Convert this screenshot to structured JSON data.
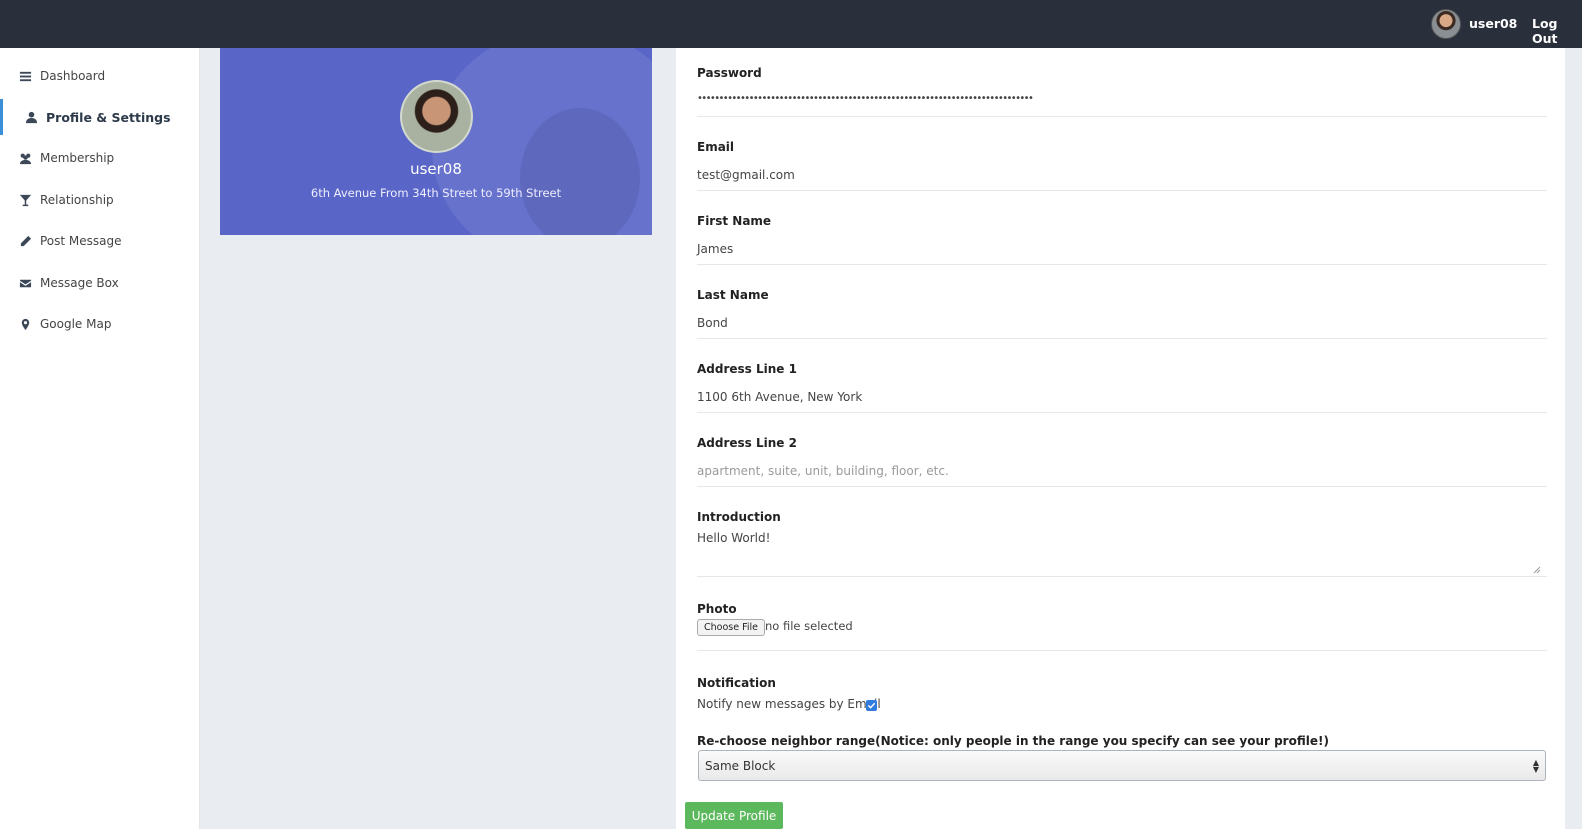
{
  "topbar": {
    "username": "user08",
    "logout": "Log Out"
  },
  "sidebar": {
    "items": [
      {
        "label": "Dashboard",
        "icon": "bars-icon"
      },
      {
        "label": "Profile & Settings",
        "icon": "user-icon"
      },
      {
        "label": "Membership",
        "icon": "users-icon"
      },
      {
        "label": "Relationship",
        "icon": "glass-icon"
      },
      {
        "label": "Post Message",
        "icon": "pencil-icon"
      },
      {
        "label": "Message Box",
        "icon": "envelope-icon"
      },
      {
        "label": "Google Map",
        "icon": "map-marker-icon"
      }
    ],
    "active": "Profile & Settings"
  },
  "hero": {
    "username": "user08",
    "address": "6th Avenue From 34th Street to 59th Street"
  },
  "form": {
    "password": {
      "label": "Password",
      "value": "••••••••••••••••••••••••••••••••••••••••••••••••••••••••••••••••••••••••••••••"
    },
    "email": {
      "label": "Email",
      "value": "test@gmail.com"
    },
    "first_name": {
      "label": "First Name",
      "value": "James"
    },
    "last_name": {
      "label": "Last Name",
      "value": "Bond"
    },
    "address1": {
      "label": "Address Line 1",
      "value": "1100 6th Avenue, New York"
    },
    "address2": {
      "label": "Address Line 2",
      "placeholder": "apartment, suite, unit, building, floor, etc."
    },
    "introduction": {
      "label": "Introduction",
      "value": "Hello World!"
    },
    "photo": {
      "label": "Photo",
      "button": "Choose File",
      "status": "no file selected"
    },
    "notification": {
      "label": "Notification",
      "option": "Notify new messages by Email",
      "checked": true
    },
    "neighbor": {
      "label": "Re-choose neighbor range(Notice: only people in the range you specify can see your profile!)",
      "selected": "Same Block"
    },
    "submit": "Update Profile"
  },
  "colors": {
    "topbar": "#2a2f3c",
    "hero": "#5966c8",
    "accent": "#3a8fd9",
    "submit": "#5cb85c"
  }
}
